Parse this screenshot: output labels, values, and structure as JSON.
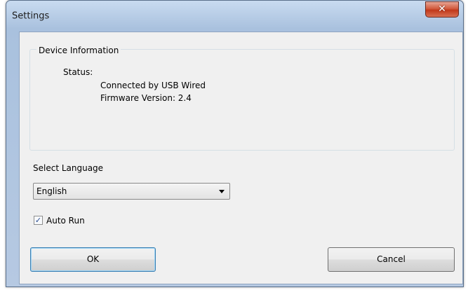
{
  "window": {
    "title": "Settings",
    "close_icon": "close-icon"
  },
  "device_info": {
    "group_label": "Device Information",
    "status_label": "Status:",
    "connection": "Connected by USB Wired",
    "firmware": "Firmware Version: 2.4"
  },
  "language": {
    "label": "Select Language",
    "selected": "English"
  },
  "auto_run": {
    "label": "Auto Run",
    "checked": true
  },
  "buttons": {
    "ok": "OK",
    "cancel": "Cancel"
  },
  "colors": {
    "close_button": "#c1391b",
    "default_button_border": "#3c7fb1"
  }
}
